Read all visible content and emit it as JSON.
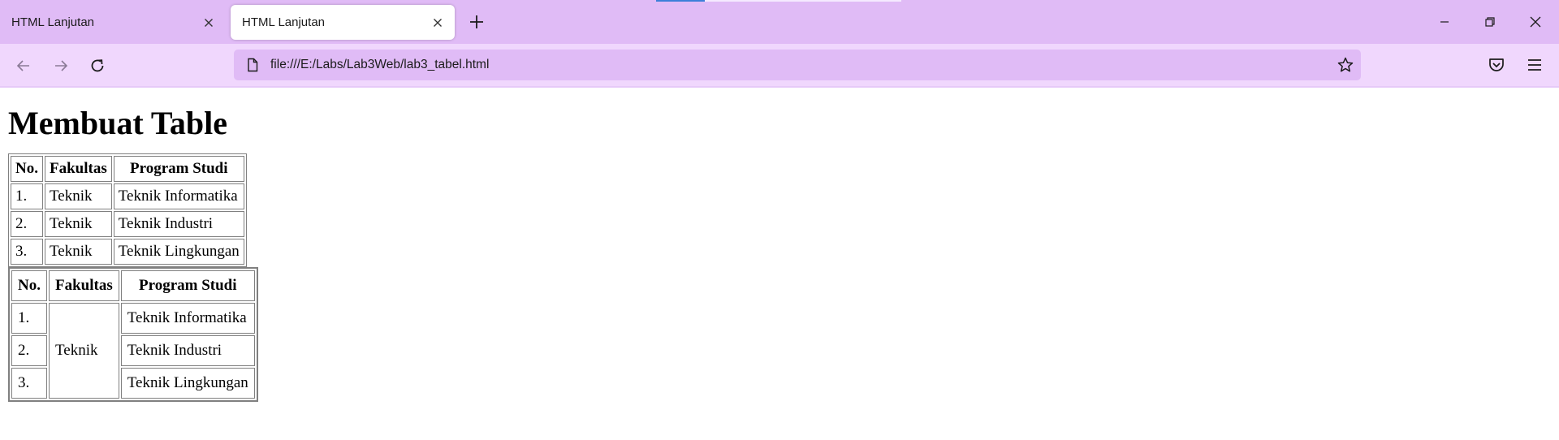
{
  "browser": {
    "tabs": [
      {
        "title": "HTML Lanjutan",
        "active": false
      },
      {
        "title": "HTML Lanjutan",
        "active": true
      }
    ],
    "url": "file:///E:/Labs/Lab3Web/lab3_tabel.html",
    "colors": {
      "tabbar": "#e0bbf6",
      "navbar": "#f0d7fd",
      "urlbar": "#e0bbf6"
    }
  },
  "page": {
    "heading": "Membuat Table",
    "table1": {
      "headers": [
        "No.",
        "Fakultas",
        "Program Studi"
      ],
      "rows": [
        [
          "1.",
          "Teknik",
          "Teknik Informatika"
        ],
        [
          "2.",
          "Teknik",
          "Teknik Industri"
        ],
        [
          "3.",
          "Teknik",
          "Teknik Lingkungan"
        ]
      ]
    },
    "table2": {
      "headers": [
        "No.",
        "Fakultas",
        "Program Studi"
      ],
      "numbers": [
        "1.",
        "2.",
        "3."
      ],
      "fakultas_merged": "Teknik",
      "programs": [
        "Teknik Informatika",
        "Teknik Industri",
        "Teknik Lingkungan"
      ]
    }
  }
}
